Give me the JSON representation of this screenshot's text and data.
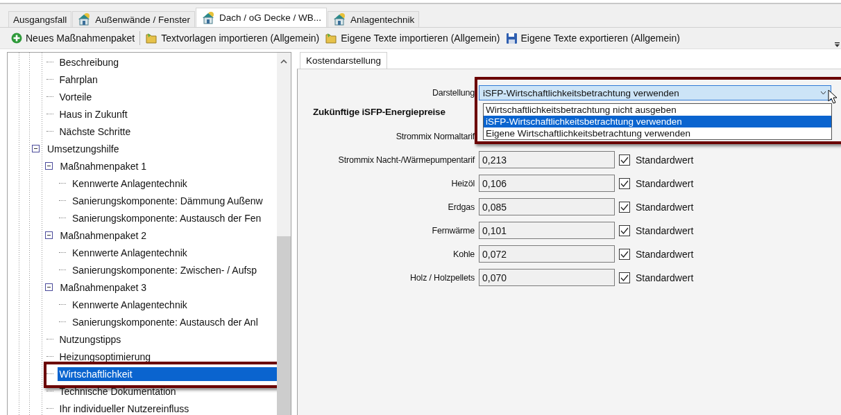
{
  "tabs": [
    {
      "label": "Ausgangsfall",
      "icon": false,
      "selected": false
    },
    {
      "label": "Außenwände / Fenster",
      "icon": true,
      "selected": false
    },
    {
      "label": "Dach / oG Decke / WB...",
      "icon": true,
      "selected": true
    },
    {
      "label": "Anlagentechnik",
      "icon": true,
      "selected": false
    }
  ],
  "toolbar": [
    {
      "kind": "add",
      "label": "Neues Maßnahmenpaket"
    },
    {
      "kind": "import",
      "label": "Textvorlagen importieren (Allgemein)"
    },
    {
      "kind": "import",
      "label": "Eigene Texte importieren (Allgemein)"
    },
    {
      "kind": "save",
      "label": "Eigene Texte exportieren (Allgemein)"
    }
  ],
  "tree": {
    "continued_items": [
      {
        "label": "Beschreibung",
        "selected": false,
        "annotated": false
      },
      {
        "label": "Fahrplan",
        "selected": false,
        "annotated": false
      },
      {
        "label": "Vorteile",
        "selected": false,
        "annotated": false
      },
      {
        "label": "Haus in Zukunft",
        "selected": false,
        "annotated": false
      },
      {
        "label": "Nächste Schritte",
        "selected": false,
        "annotated": false
      }
    ],
    "items": [
      {
        "label": "Umsetzungshilfe",
        "selected": false,
        "annotated": false,
        "expanded": true,
        "children": [
          {
            "label": "Maßnahmenpaket 1",
            "selected": false,
            "annotated": false,
            "expanded": true,
            "children": [
              {
                "label": "Kennwerte Anlagentechnik",
                "selected": false,
                "annotated": false
              },
              {
                "label": "Sanierungskomponente: Dämmung Außenw",
                "selected": false,
                "annotated": false
              },
              {
                "label": "Sanierungskomponente: Austausch der Fen",
                "selected": false,
                "annotated": false
              }
            ]
          },
          {
            "label": "Maßnahmenpaket 2",
            "selected": false,
            "annotated": false,
            "expanded": true,
            "children": [
              {
                "label": "Kennwerte Anlagentechnik",
                "selected": false,
                "annotated": false
              },
              {
                "label": "Sanierungskomponente: Zwischen- / Aufsp",
                "selected": false,
                "annotated": false
              }
            ]
          },
          {
            "label": "Maßnahmenpaket 3",
            "selected": false,
            "annotated": false,
            "expanded": true,
            "children": [
              {
                "label": "Kennwerte Anlagentechnik",
                "selected": false,
                "annotated": false
              },
              {
                "label": "Sanierungskomponente: Austausch der Anl",
                "selected": false,
                "annotated": false
              }
            ]
          },
          {
            "label": "Nutzungstipps",
            "selected": false,
            "annotated": false
          },
          {
            "label": "Heizungsoptimierung",
            "selected": false,
            "annotated": false
          },
          {
            "label": "Wirtschaftlichkeit",
            "selected": true,
            "annotated": true
          },
          {
            "label": "Technische Dokumentation",
            "selected": false,
            "annotated": false
          },
          {
            "label": "Ihr individueller Nutzereinfluss",
            "selected": false,
            "annotated": false
          }
        ]
      }
    ]
  },
  "detail": {
    "tabs": [
      {
        "label": "Kostendarstellung",
        "selected": true
      }
    ],
    "darstellung": {
      "label": "Darstellung",
      "value": "iSFP-Wirtschaftlichkeitsbetrachtung verwenden",
      "annotated": true,
      "options": [
        {
          "label": "Wirtschaftlichkeitsbetrachtung nicht ausgeben",
          "selected": false
        },
        {
          "label": "iSFP-Wirtschaftlichkeitsbetrachtung verwenden",
          "selected": true
        },
        {
          "label": "Eigene Wirtschaftlichkeitsbetrachtung verwenden",
          "selected": false
        }
      ]
    },
    "heading": "Zukünftige iSFP-Energiepreise",
    "prices": [
      {
        "label": "Strommix Normaltarif"
      },
      {
        "label": "Strommix Nacht-/Wärmepumpentarif",
        "value": "0,213",
        "checked": true,
        "checkbox_label": "Standardwert"
      },
      {
        "label": "Heizöl",
        "value": "0,106",
        "checked": true,
        "checkbox_label": "Standardwert"
      },
      {
        "label": "Erdgas",
        "value": "0,085",
        "checked": true,
        "checkbox_label": "Standardwert"
      },
      {
        "label": "Fernwärme",
        "value": "0,101",
        "checked": true,
        "checkbox_label": "Standardwert"
      },
      {
        "label": "Kohle",
        "value": "0,072",
        "checked": true,
        "checkbox_label": "Standardwert"
      },
      {
        "label": "Holz / Holzpellets",
        "value": "0,070",
        "checked": true,
        "checkbox_label": "Standardwert"
      }
    ]
  }
}
